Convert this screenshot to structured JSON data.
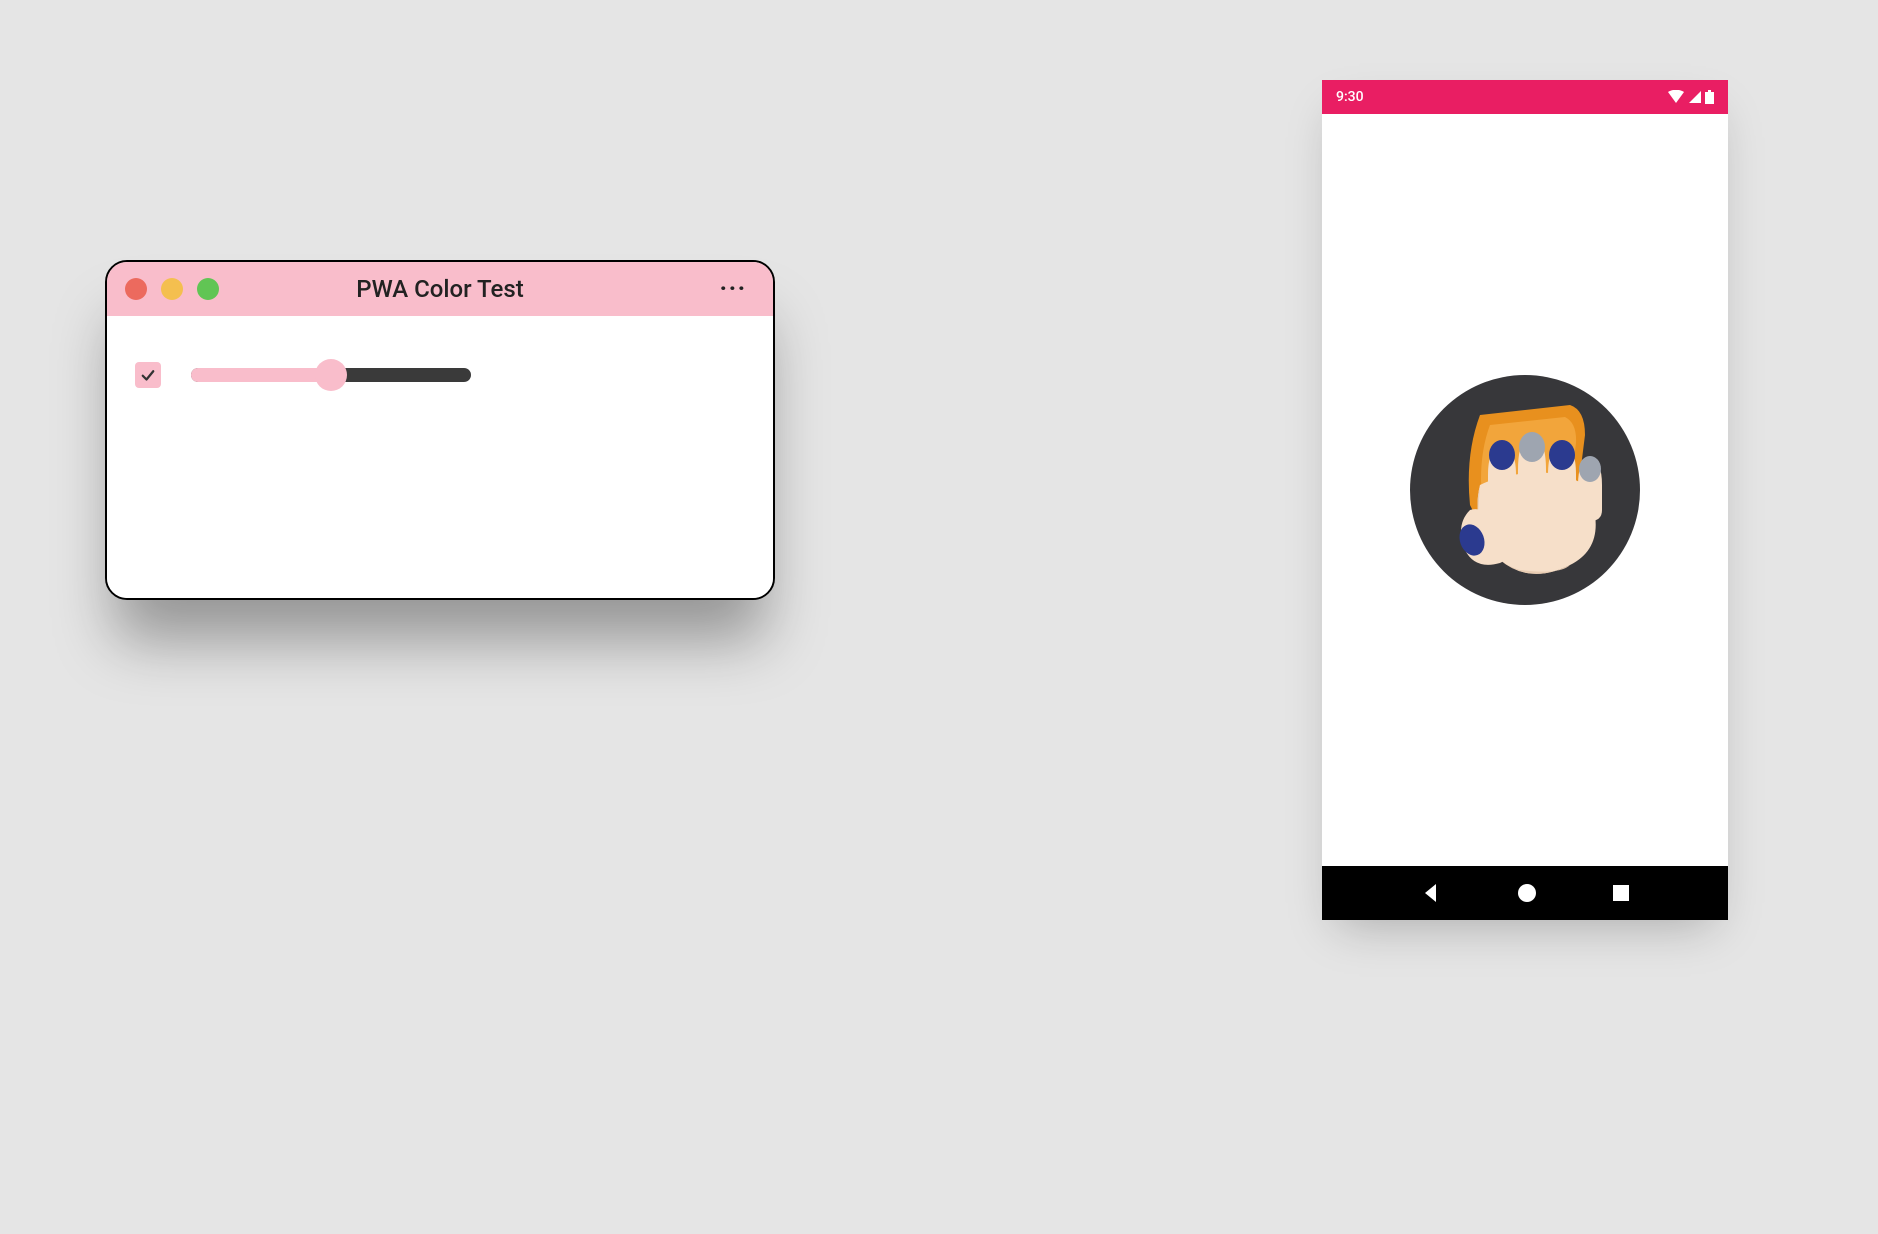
{
  "mac": {
    "title": "PWA Color Test",
    "checkbox_checked": true,
    "slider_percent": 50,
    "colors": {
      "accent": "#f9bdcb",
      "traffic_close": "#ec6a5e",
      "traffic_min": "#f4bf4f",
      "traffic_max": "#61c554"
    },
    "icons": {
      "more": "more-options-icon",
      "close": "close-traffic-light",
      "minimize": "minimize-traffic-light",
      "maximize": "maximize-traffic-light"
    }
  },
  "phone": {
    "status_time": "9:30",
    "status_bar_color": "#e91e63",
    "nav_bar_color": "#000000",
    "icons": {
      "wifi": "wifi-icon",
      "signal": "signal-icon",
      "battery": "battery-icon",
      "back": "back-icon",
      "home": "home-icon",
      "recent": "recent-apps-icon",
      "app": "squoosh-app-icon"
    }
  }
}
